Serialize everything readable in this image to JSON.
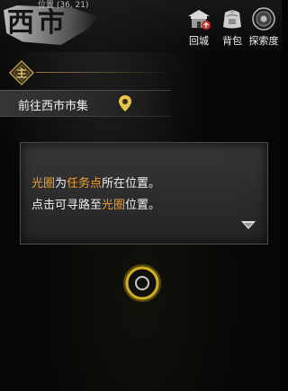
{
  "header": {
    "coords_label": "位置 (36, 21)",
    "city_name": "西市"
  },
  "menu": [
    {
      "label": "回城",
      "icon": "return-city-icon"
    },
    {
      "label": "背包",
      "icon": "backpack-icon"
    },
    {
      "label": "探索度",
      "icon": "exploration-icon"
    }
  ],
  "quest": {
    "badge_char": "主",
    "objective": "前往西市市集",
    "location_icon": "map-pin-icon"
  },
  "tip": {
    "line1": [
      "光圈",
      "为",
      "任务点",
      "所在位置。"
    ],
    "line2": [
      "点击可寻路至",
      "光圈",
      "位置。"
    ]
  },
  "colors": {
    "highlight": "#f0a030",
    "ring": "#d4b020"
  }
}
